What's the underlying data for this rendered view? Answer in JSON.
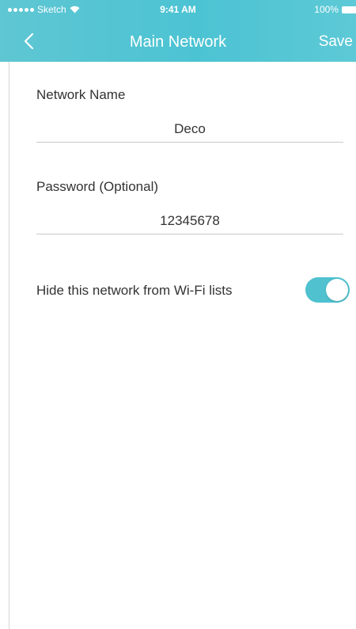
{
  "status_bar": {
    "carrier": "Sketch",
    "time": "9:41 AM",
    "battery": "100%"
  },
  "nav": {
    "title": "Main Network",
    "save_label": "Save",
    "back_icon": "chevron-left-icon"
  },
  "form": {
    "network_name": {
      "label": "Network Name",
      "value": "Deco"
    },
    "password": {
      "label": "Password (Optional)",
      "value": "12345678"
    },
    "hide_network": {
      "label": "Hide this network from Wi-Fi lists",
      "enabled": true
    }
  },
  "colors": {
    "accent": "#4fc1cf",
    "header": "#55c5d4",
    "text": "#333333",
    "divider": "#c9c9c9"
  }
}
